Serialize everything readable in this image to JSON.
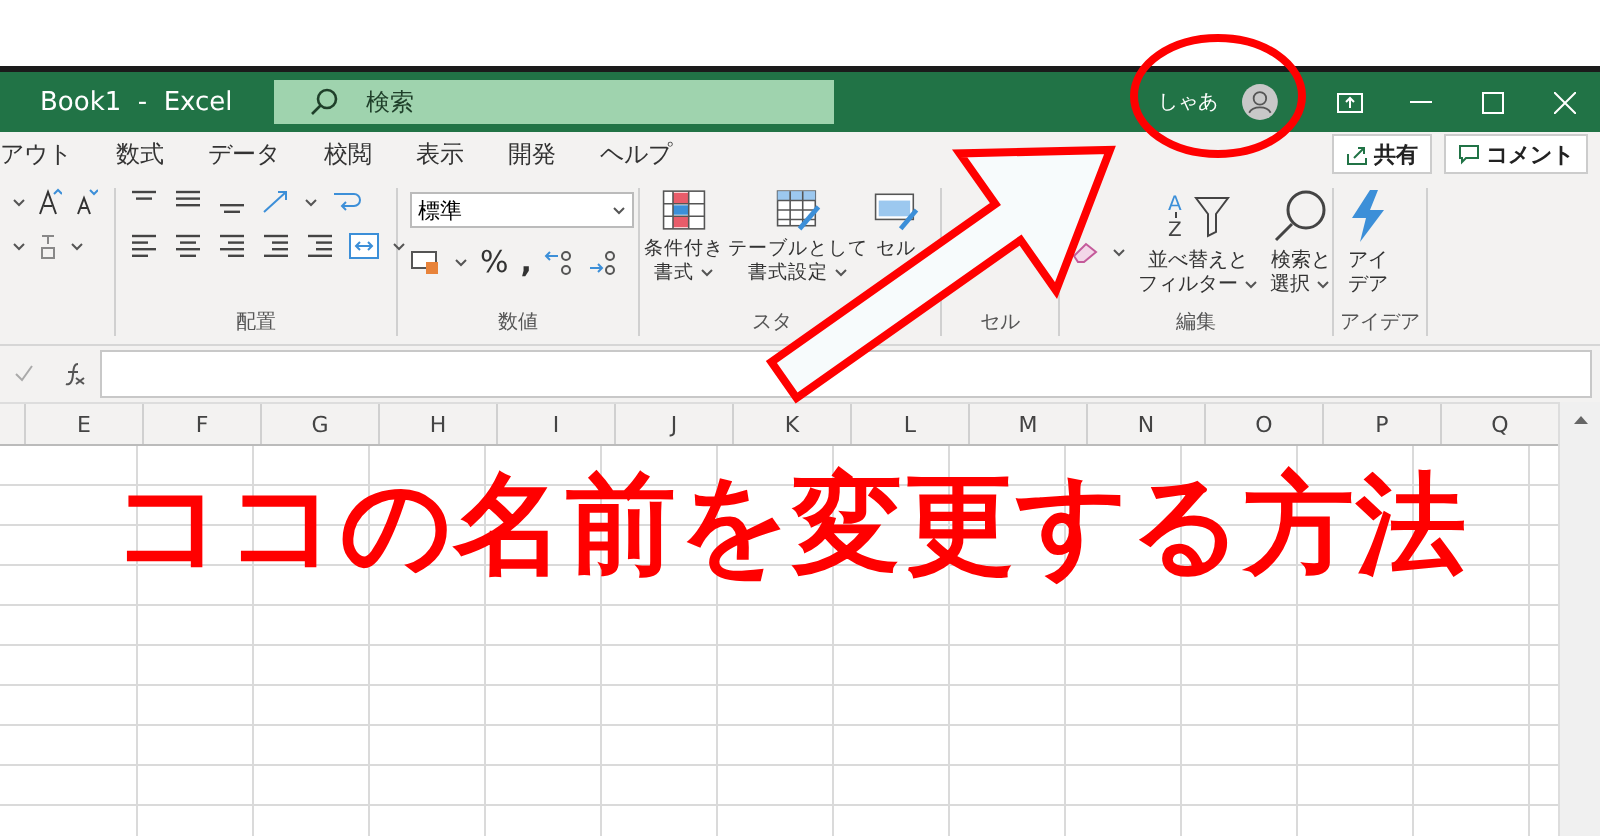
{
  "title_bar": {
    "title": "Book1  -  Excel",
    "search": {
      "placeholder": "検索"
    },
    "user_name": "しゃあ",
    "window_controls": [
      {
        "kind": "ribbon-display"
      },
      {
        "kind": "minimize"
      },
      {
        "kind": "maximize"
      },
      {
        "kind": "close"
      }
    ]
  },
  "tabs": [
    "アウト",
    "数式",
    "データ",
    "校閲",
    "表示",
    "開発",
    "ヘルプ"
  ],
  "share_button": "共有",
  "comment_button": "コメント",
  "ribbon": {
    "alignment": {
      "label": "配置"
    },
    "number": {
      "label": "数値",
      "format": "標準",
      "percent": "%",
      "comma": ","
    },
    "styles": {
      "label": "スタ",
      "buttons": [
        {
          "kind": "conditional",
          "lines": [
            "条件付き",
            "書式"
          ]
        },
        {
          "kind": "table",
          "lines": [
            "テーブルとして",
            "書式設定"
          ]
        },
        {
          "kind": "cell-style",
          "lines": [
            "セル"
          ]
        }
      ]
    },
    "cells": {
      "label": "セル"
    },
    "editing": {
      "label": "編集",
      "buttons": [
        {
          "kind": "sort",
          "icon_text": [
            "A",
            "Z"
          ],
          "lines": [
            "並べ替えと",
            "フィルター"
          ]
        },
        {
          "kind": "find",
          "lines": [
            "検索と",
            "選択"
          ]
        }
      ]
    },
    "ideas": {
      "label": "アイデア",
      "lines": [
        "アイ",
        "デア"
      ]
    }
  },
  "columns": [
    "E",
    "F",
    "G",
    "H",
    "I",
    "J",
    "K",
    "L",
    "M",
    "N",
    "O",
    "P",
    "Q"
  ],
  "annotation": {
    "caption": "ココの名前を変更する方法"
  }
}
